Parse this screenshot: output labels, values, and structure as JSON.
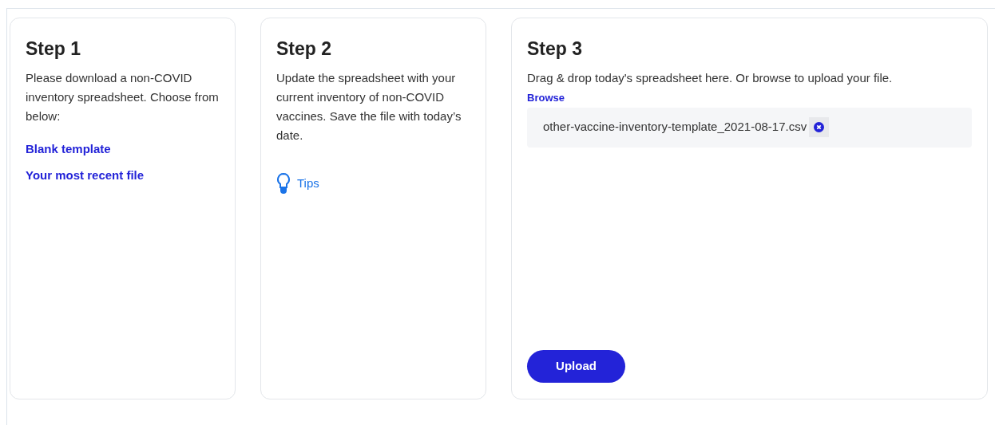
{
  "steps": [
    {
      "title": "Step 1",
      "text": "Please download a non-COVID inventory spreadsheet. Choose from below:",
      "links": [
        "Blank template",
        "Your most recent file"
      ]
    },
    {
      "title": "Step 2",
      "text": "Update the spreadsheet with your current inventory of non-COVID vaccines. Save the file with today’s date.",
      "tip": "Tips"
    },
    {
      "title": "Step 3",
      "text": "Drag & drop today's spreadsheet here. Or browse to upload your file.",
      "browse": "Browse",
      "file": "other-vaccine-inventory-template_2021-08-17.csv",
      "upload": "Upload"
    }
  ]
}
